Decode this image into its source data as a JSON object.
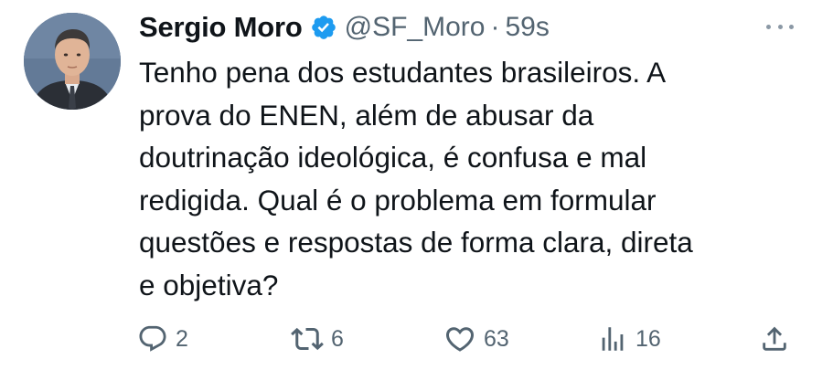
{
  "tweet": {
    "author": {
      "display_name": "Sergio Moro",
      "handle": "@SF_Moro",
      "verified": true
    },
    "separator": "·",
    "timestamp": "59s",
    "text": "Tenho pena dos estudantes brasileiros. A\nprova do ENEN, além de abusar da\ndoutrinação ideológica, é confusa e mal\nredigida. Qual é o problema em formular\nquestões e respostas de forma clara, direta\ne objetiva?",
    "actions": {
      "replies": "2",
      "reposts": "6",
      "likes": "63",
      "views": "16"
    },
    "icons": {
      "more": "more-icon",
      "reply": "reply-icon",
      "repost": "repost-icon",
      "like": "heart-icon",
      "views": "views-icon",
      "share": "share-icon",
      "verified": "verified-badge-icon"
    },
    "colors": {
      "text": "#0f1419",
      "secondary": "#536471",
      "verified_badge": "#1d9bf0"
    }
  }
}
